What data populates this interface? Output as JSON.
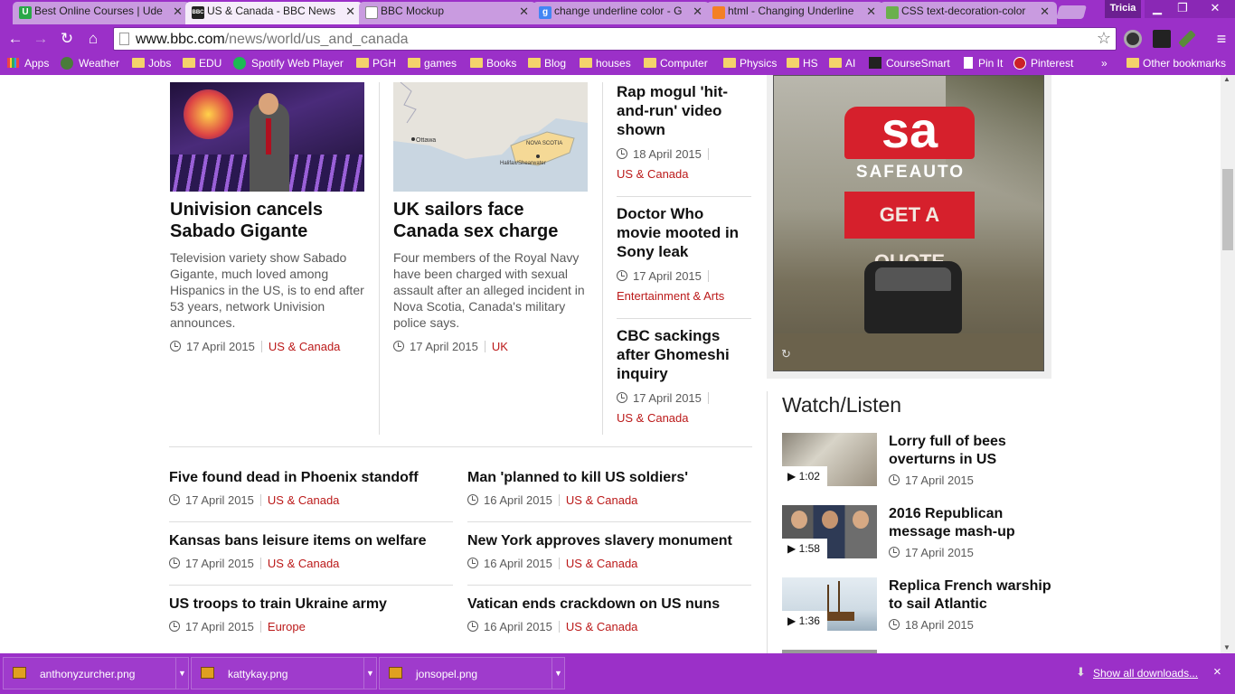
{
  "browser": {
    "tabs": [
      {
        "title": "Best Online Courses | Ude",
        "favicon": "U",
        "color": "#2aa847"
      },
      {
        "title": "US & Canada - BBC News",
        "favicon": "BBC",
        "color": "#222"
      },
      {
        "title": "BBC Mockup",
        "favicon": "doc",
        "color": "#fff"
      },
      {
        "title": "change underline color - G",
        "favicon": "g",
        "color": "#4285f4"
      },
      {
        "title": "html - Changing Underline",
        "favicon": "so",
        "color": "#f48024"
      },
      {
        "title": "CSS text-decoration-color",
        "favicon": "css",
        "color": "#6ab04c"
      }
    ],
    "user_name": "Tricia",
    "url_host": "www.bbc.com",
    "url_path": "/news/world/us_and_canada",
    "bookmarks": [
      "Apps",
      "Weather",
      "Jobs",
      "EDU",
      "Spotify Web Player",
      "PGH",
      "games",
      "Books",
      "Blog",
      "houses",
      "Computer",
      "Physics",
      "HS",
      "AI",
      "CourseSmart",
      "Pin It",
      "Pinterest"
    ],
    "more_bookmarks": "»",
    "other_bookmarks": "Other bookmarks"
  },
  "top_stories": [
    {
      "headline": "Univision cancels Sabado Gigante",
      "summary": "Television variety show Sabado Gigante, much loved among Hispanics in the US, is to end after 53 years, network Univision announces.",
      "date": "17 April 2015",
      "section": "US & Canada"
    },
    {
      "headline": "UK sailors face Canada sex charge",
      "summary": "Four members of the Royal Navy have been charged with sexual assault after an alleged incident in Nova Scotia, Canada's military police says.",
      "date": "17 April 2015",
      "section": "UK",
      "map_labels": [
        "Ottawa",
        "NOVA SCOTIA",
        "Halifax/Shearwater"
      ]
    }
  ],
  "side_stories": [
    {
      "headline": "Rap mogul 'hit-and-run' video shown",
      "date": "18 April 2015",
      "section": "US & Canada"
    },
    {
      "headline": "Doctor Who movie mooted in Sony leak",
      "date": "17 April 2015",
      "section": "Entertainment & Arts"
    },
    {
      "headline": "CBC sackings after Ghomeshi inquiry",
      "date": "17 April 2015",
      "section": "US & Canada"
    }
  ],
  "list_stories": [
    {
      "headline": "Five found dead in Phoenix standoff",
      "date": "17 April 2015",
      "section": "US & Canada"
    },
    {
      "headline": "Man 'planned to kill US soldiers'",
      "date": "16 April 2015",
      "section": "US & Canada"
    },
    {
      "headline": "Kansas bans leisure items on welfare",
      "date": "17 April 2015",
      "section": "US & Canada"
    },
    {
      "headline": "New York approves slavery monument",
      "date": "16 April 2015",
      "section": "US & Canada"
    },
    {
      "headline": "US troops to train Ukraine army",
      "date": "17 April 2015",
      "section": "Europe"
    },
    {
      "headline": "Vatican ends crackdown on US nuns",
      "date": "16 April 2015",
      "section": "US & Canada"
    }
  ],
  "ad": {
    "brand": "SAFEAUTO",
    "logo": "sa",
    "cta": "GET A QUOTE"
  },
  "watch_listen": {
    "title": "Watch/Listen",
    "items": [
      {
        "headline": "Lorry full of bees overturns in US",
        "date": "17 April 2015",
        "duration": "1:02"
      },
      {
        "headline": "2016 Republican message mash-up",
        "date": "17 April 2015",
        "duration": "1:58"
      },
      {
        "headline": "Replica French warship to sail Atlantic",
        "date": "18 April 2015",
        "duration": "1:36"
      }
    ]
  },
  "downloads": {
    "files": [
      "anthonyzurcher.png",
      "kattykay.png",
      "jonsopel.png"
    ],
    "show_all": "Show all downloads...",
    "close": "×"
  },
  "colors": {
    "chrome_purple": "#9b30c8",
    "bbc_red": "#bb1919",
    "ad_red": "#d6202c"
  }
}
